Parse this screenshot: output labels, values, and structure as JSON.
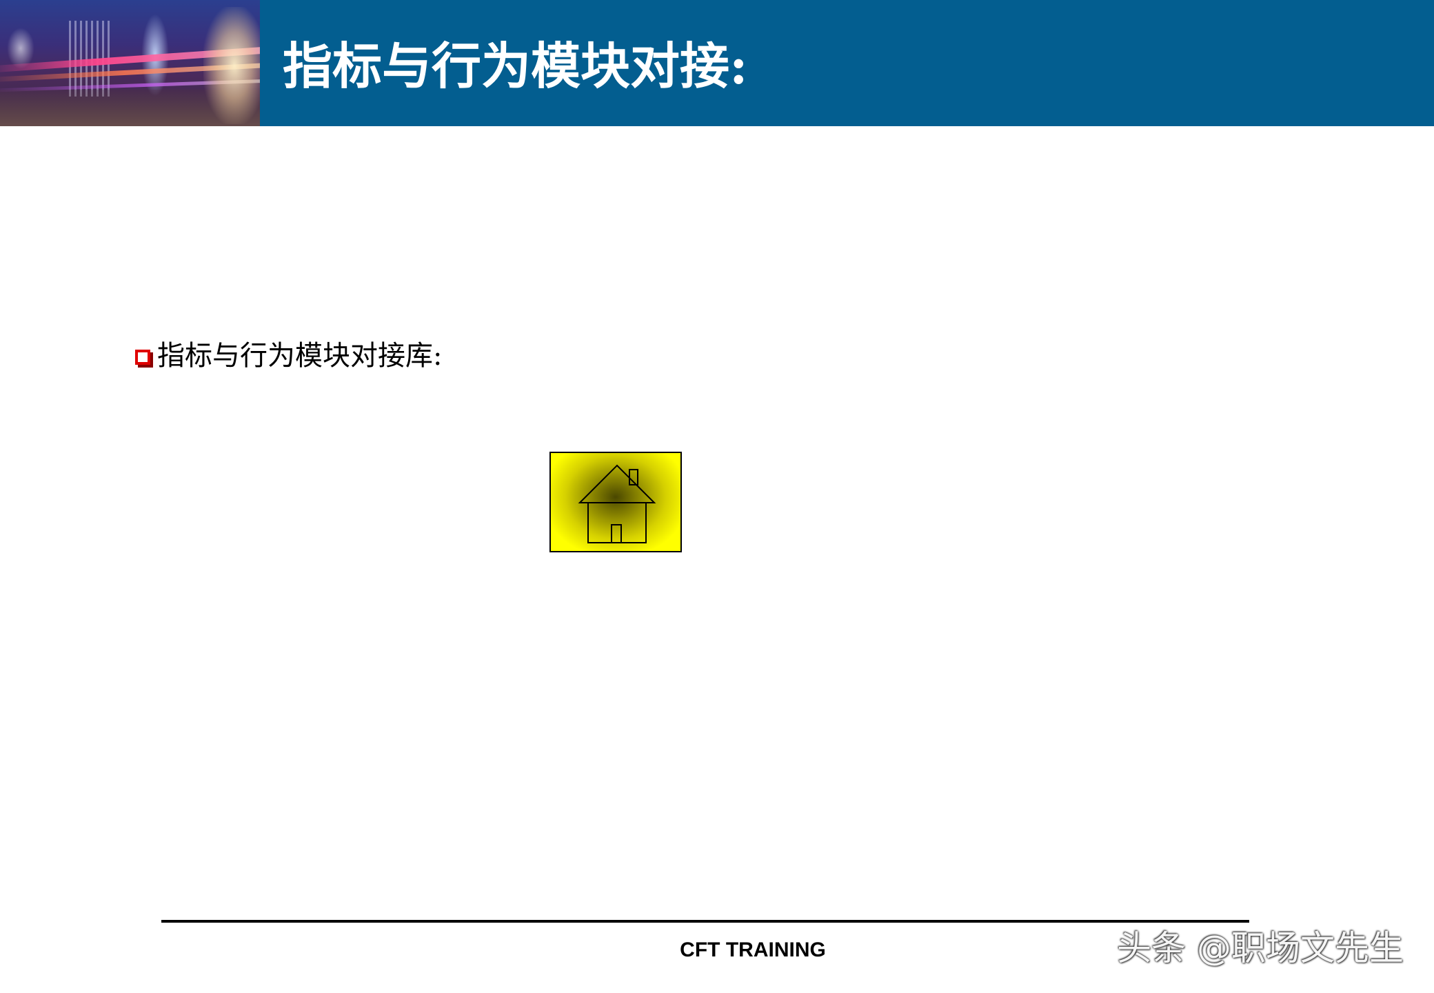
{
  "header": {
    "title": "指标与行为模块对接:",
    "accent_color": "#035e90"
  },
  "body": {
    "bullet_text": "指标与行为模块对接库:",
    "bullet_color": "#e00000",
    "home_button": {
      "icon": "house-icon",
      "fill_color": "#ffff00"
    }
  },
  "footer": {
    "label": "CFT TRAINING"
  },
  "watermark": {
    "text": "头条 @职场文先生"
  }
}
